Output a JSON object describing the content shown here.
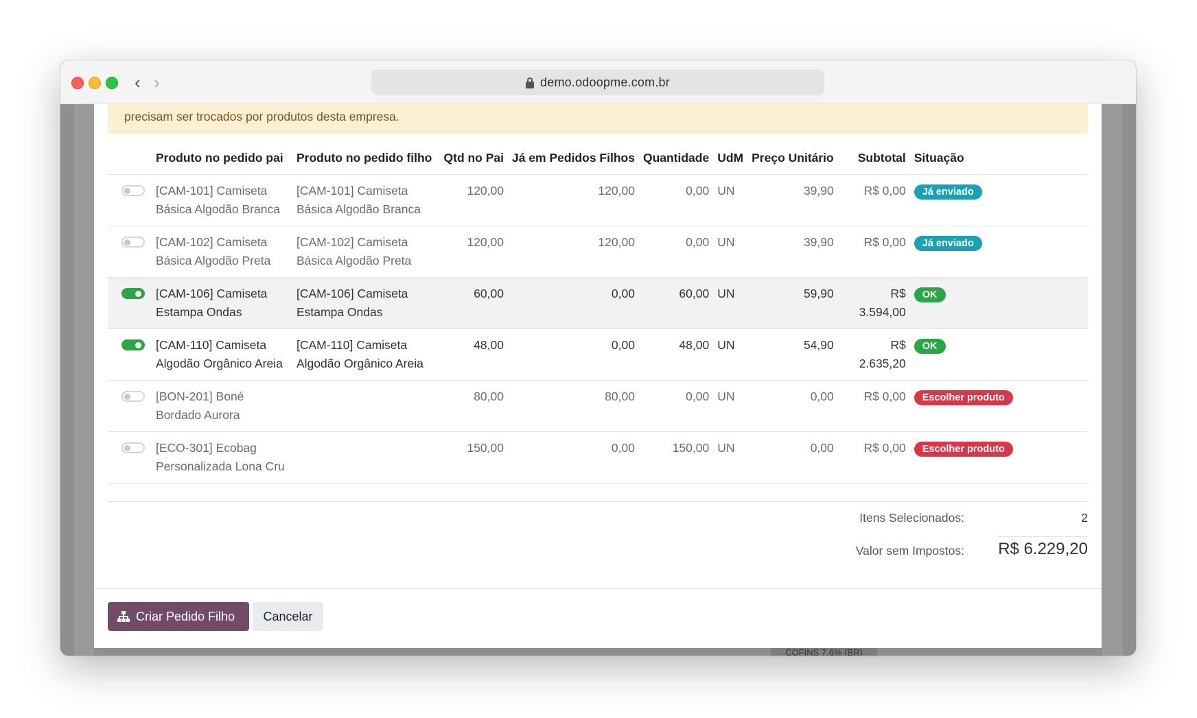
{
  "browser": {
    "url": "demo.odoopme.com.br"
  },
  "alert": {
    "text": "precisam ser trocados por produtos desta empresa."
  },
  "table": {
    "headers": [
      "Produto no pedido pai",
      "Produto no pedido filho",
      "Qtd no Pai",
      "Já em Pedidos Filhos",
      "Quantidade",
      "UdM",
      "Preço Unitário",
      "Subtotal",
      "Situação"
    ],
    "rows": [
      {
        "selected": false,
        "parent": "[CAM-101] Camiseta Básica Algodão Branca",
        "child": "[CAM-101] Camiseta Básica Algodão Branca",
        "qty_parent": "120,00",
        "already": "120,00",
        "quantity": "0,00",
        "uom": "UN",
        "price": "39,90",
        "subtotal": "R$ 0,00",
        "status": "Já enviado",
        "status_type": "sent"
      },
      {
        "selected": false,
        "parent": "[CAM-102] Camiseta Básica Algodão Preta",
        "child": "[CAM-102] Camiseta Básica Algodão Preta",
        "qty_parent": "120,00",
        "already": "120,00",
        "quantity": "0,00",
        "uom": "UN",
        "price": "39,90",
        "subtotal": "R$ 0,00",
        "status": "Já enviado",
        "status_type": "sent"
      },
      {
        "selected": true,
        "parent": "[CAM-106] Camiseta Estampa Ondas",
        "child": "[CAM-106] Camiseta Estampa Ondas",
        "qty_parent": "60,00",
        "already": "0,00",
        "quantity": "60,00",
        "uom": "UN",
        "price": "59,90",
        "subtotal": "R$ 3.594,00",
        "status": "OK",
        "status_type": "ok"
      },
      {
        "selected": true,
        "parent": "[CAM-110] Camiseta Algodão Orgânico Areia",
        "child": "[CAM-110] Camiseta Algodão Orgânico Areia",
        "qty_parent": "48,00",
        "already": "0,00",
        "quantity": "48,00",
        "uom": "UN",
        "price": "54,90",
        "subtotal": "R$ 2.635,20",
        "status": "OK",
        "status_type": "ok"
      },
      {
        "selected": false,
        "parent": "[BON-201] Boné Bordado Aurora",
        "child": "",
        "qty_parent": "80,00",
        "already": "80,00",
        "quantity": "0,00",
        "uom": "UN",
        "price": "0,00",
        "subtotal": "R$ 0,00",
        "status": "Escolher produto",
        "status_type": "choose"
      },
      {
        "selected": false,
        "parent": "[ECO-301] Ecobag Personalizada Lona Cru",
        "child": "",
        "qty_parent": "150,00",
        "already": "0,00",
        "quantity": "150,00",
        "uom": "UN",
        "price": "0,00",
        "subtotal": "R$ 0,00",
        "status": "Escolher produto",
        "status_type": "choose"
      }
    ]
  },
  "totals": {
    "selected_label": "Itens Selecionados:",
    "selected_value": "2",
    "untaxed_label": "Valor sem Impostos:",
    "untaxed_value": "R$ 6.229,20"
  },
  "footer": {
    "create_label": "Criar Pedido Filho",
    "cancel_label": "Cancelar"
  },
  "background": {
    "cofins_label": "COFINS 7,6% (BR)"
  },
  "colors": {
    "primary": "#714b67",
    "badge_sent": "#17a2b8",
    "badge_ok": "#28a745",
    "badge_choose": "#dc3545",
    "alert_bg": "#fcefd2"
  }
}
